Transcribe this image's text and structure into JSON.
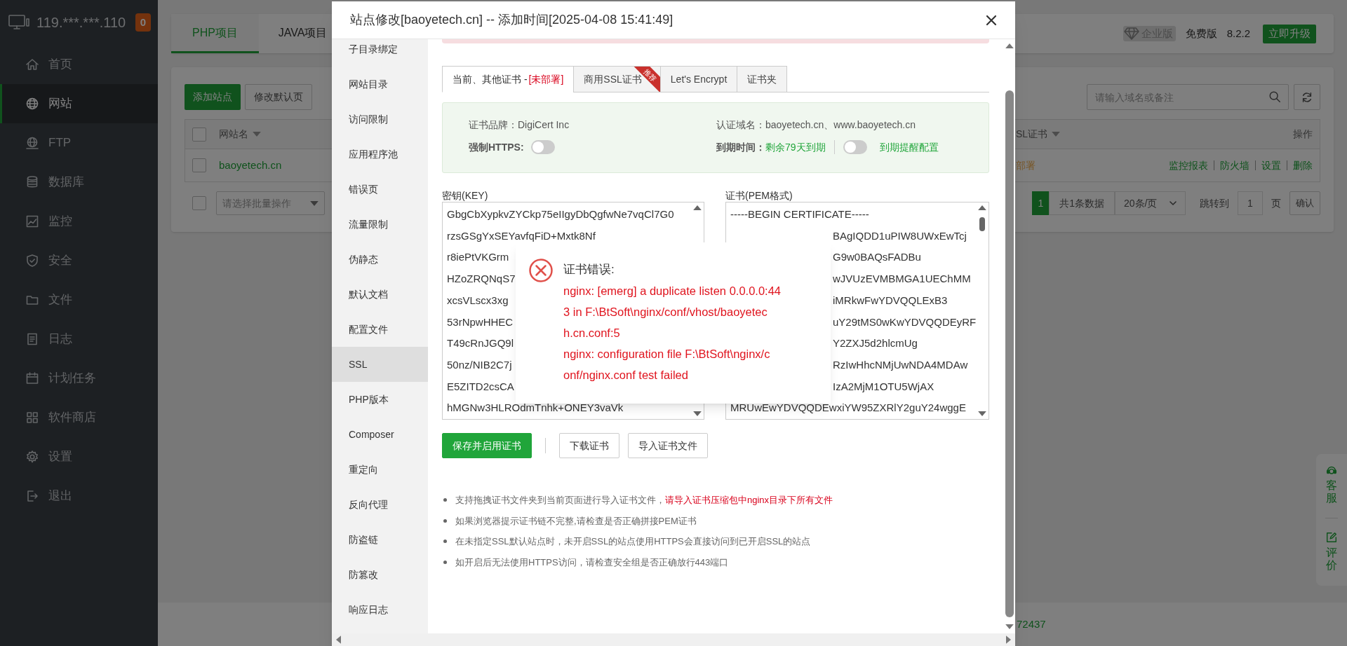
{
  "sidebar": {
    "host": "119.***.***.110",
    "badge": "0",
    "items": [
      {
        "label": "首页",
        "selected": false
      },
      {
        "label": "网站",
        "selected": true
      },
      {
        "label": "FTP",
        "selected": false
      },
      {
        "label": "数据库",
        "selected": false
      },
      {
        "label": "监控",
        "selected": false
      },
      {
        "label": "安全",
        "selected": false
      },
      {
        "label": "文件",
        "selected": false
      },
      {
        "label": "日志",
        "selected": false
      },
      {
        "label": "计划任务",
        "selected": false
      },
      {
        "label": "软件商店",
        "selected": false
      },
      {
        "label": "设置",
        "selected": false
      },
      {
        "label": "退出",
        "selected": false
      }
    ]
  },
  "top_tabs": [
    {
      "label": "PHP项目",
      "selected": true
    },
    {
      "label": "JAVA项目",
      "selected": false
    }
  ],
  "edition": {
    "badge": "企业版",
    "plan": "免费版",
    "version": "8.2.2",
    "upgrade_button": "立即升级"
  },
  "toolbar": {
    "buttons": [
      "添加站点",
      "修改默认页"
    ],
    "search_placeholder": "请输入域名或备注"
  },
  "table": {
    "header_checked": false,
    "columns": [
      "网站名",
      "SL证书",
      "操作"
    ],
    "rows": [
      {
        "checked": false,
        "name": "baoyetech.cn",
        "ssl": "部署",
        "actions": [
          "监控报表",
          "防火墙",
          "设置",
          "删除"
        ]
      }
    ]
  },
  "batch": {
    "checked": false,
    "placeholder": "请选择批量操作"
  },
  "pagination": {
    "pages": [
      {
        "label": "1",
        "selected": true
      }
    ],
    "total": "共1条数据",
    "per_page": "20条/页",
    "jump_label": "跳转到",
    "jump_value": "1",
    "page_unit": "页",
    "confirm": "确认"
  },
  "footer_text": "72437",
  "float_widget": [
    "客服",
    "评价"
  ],
  "dialog": {
    "title": "站点修改[baoyetech.cn] -- 添加时间[2025-04-08 15:41:49]",
    "nav": [
      {
        "label": "子目录绑定",
        "selected": false
      },
      {
        "label": "网站目录",
        "selected": false
      },
      {
        "label": "访问限制",
        "selected": false
      },
      {
        "label": "应用程序池",
        "selected": false
      },
      {
        "label": "错误页",
        "selected": false
      },
      {
        "label": "流量限制",
        "selected": false
      },
      {
        "label": "伪静态",
        "selected": false
      },
      {
        "label": "默认文档",
        "selected": false
      },
      {
        "label": "配置文件",
        "selected": false
      },
      {
        "label": "SSL",
        "selected": true
      },
      {
        "label": "PHP版本",
        "selected": false
      },
      {
        "label": "Composer",
        "selected": false
      },
      {
        "label": "重定向",
        "selected": false
      },
      {
        "label": "反向代理",
        "selected": false
      },
      {
        "label": "防盗链",
        "selected": false
      },
      {
        "label": "防篡改",
        "selected": false
      },
      {
        "label": "响应日志",
        "selected": false
      }
    ],
    "cert_tabs": [
      {
        "label": "当前、其他证书 - ",
        "status": "[未部署]",
        "selected": true
      },
      {
        "label": "商用SSL证书",
        "badge": "推荐",
        "selected": false
      },
      {
        "label": "Let's Encrypt",
        "selected": false
      },
      {
        "label": "证书夹",
        "selected": false
      }
    ],
    "info": {
      "brand": "证书品牌：DigiCert Inc",
      "domains": "认证域名：baoyetech.cn、www.baoyetech.cn",
      "force_https": {
        "label": "强制HTTPS:",
        "on": false
      },
      "expiry": {
        "label": "到期时间：",
        "remaining": "剩余79天到期",
        "reminder_on": false,
        "reminder_link": "到期提醒配置"
      }
    },
    "key": {
      "label": "密钥(KEY)",
      "lines": [
        "GbgCbXypkvZYCkp75eIIgyDbQgfwNe7vqCl7G0",
        "rzsGSgYxSEYavfqFiD+Mxtk8Nf",
        "r8iePtVKGrm",
        "HZoZRQNqS7",
        "xcsVLscx3xg",
        "53rNpwHHEC",
        "T49cRnJGQ9l",
        "50nz/NIB2C7j",
        "E5ZITD2csCA",
        "hMGNw3HLROdmTnhk+ONEY3vaVk"
      ]
    },
    "cert": {
      "label": "证书(PEM格式)",
      "lines": [
        {
          "text": "-----BEGIN CERTIFICATE-----",
          "covered": false
        },
        {
          "text": "BAgIQDD1uPIW8UWxEwTcj",
          "covered": true
        },
        {
          "text": "G9w0BAQsFADBu",
          "covered": true
        },
        {
          "text": "wJVUzEVMBMGA1UEChMM",
          "covered": true
        },
        {
          "text": "iMRkwFwYDVQQLExB3",
          "covered": true
        },
        {
          "text": "uY29tMS0wKwYDVQQDEyRF",
          "covered": true
        },
        {
          "text": "Y2ZXJ5d2hlcmUg",
          "covered": true
        },
        {
          "text": "RzIwHhcNMjUwNDA4MDAw",
          "covered": true
        },
        {
          "text": "IzA2MjM1OTU5WjAX",
          "covered": true
        },
        {
          "text": "MRUwEwYDVQQDEwxiYW95ZXRlY2guY24wggE",
          "covered": false
        }
      ]
    },
    "buttons": [
      {
        "label": "保存并启用证书",
        "kind": "primary"
      },
      {
        "label": "下载证书",
        "kind": "default"
      },
      {
        "label": "导入证书文件",
        "kind": "default"
      }
    ],
    "tips": [
      {
        "text": "支持拖拽证书文件夹到当前页面进行导入证书文件，",
        "highlight": "请导入证书压缩包中nginx目录下所有文件"
      },
      {
        "text": "如果浏览器提示证书链不完整,请检查是否正确拼接PEM证书"
      },
      {
        "text": "在未指定SSL默认站点时，未开启SSL的站点使用HTTPS会直接访问到已开启SSL的站点"
      },
      {
        "text": "如开启后无法使用HTTPS访问，请检查安全组是否正确放行443端口"
      }
    ]
  },
  "error": {
    "title": "证书错误:",
    "lines": [
      "nginx: [emerg] a duplicate listen 0.0.0.0:44",
      "3 in F:\\BtSoft\\nginx/conf/vhost/baoyetec",
      "h.cn.conf:5",
      "nginx: configuration file F:\\BtSoft\\nginx/c",
      "onf/nginx.conf test failed"
    ]
  }
}
